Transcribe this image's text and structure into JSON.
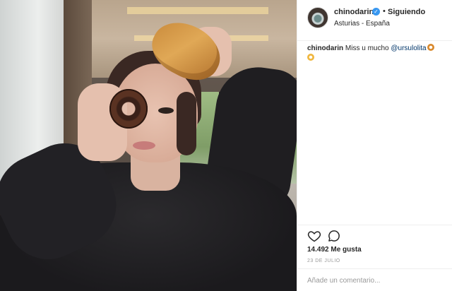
{
  "post": {
    "username": "chinodarin",
    "verified_icon": "verified-badge-icon",
    "separator": "•",
    "follow_status": "Siguiendo",
    "location": "Asturias - España"
  },
  "caption": {
    "username": "chinodarin",
    "text": "Miss u mucho",
    "mention": "@ursulolita",
    "emojis": [
      "donut-emoji",
      "cookie-emoji"
    ]
  },
  "actions": {
    "like_icon": "heart-icon",
    "comment_icon": "comment-icon"
  },
  "likes_text": "14.492 Me gusta",
  "date_text": "23 DE JULIO",
  "comment_box": {
    "placeholder": "Añade un comentario..."
  },
  "colors": {
    "verified": "#3897f0",
    "mention": "#003569",
    "muted": "#999999"
  }
}
